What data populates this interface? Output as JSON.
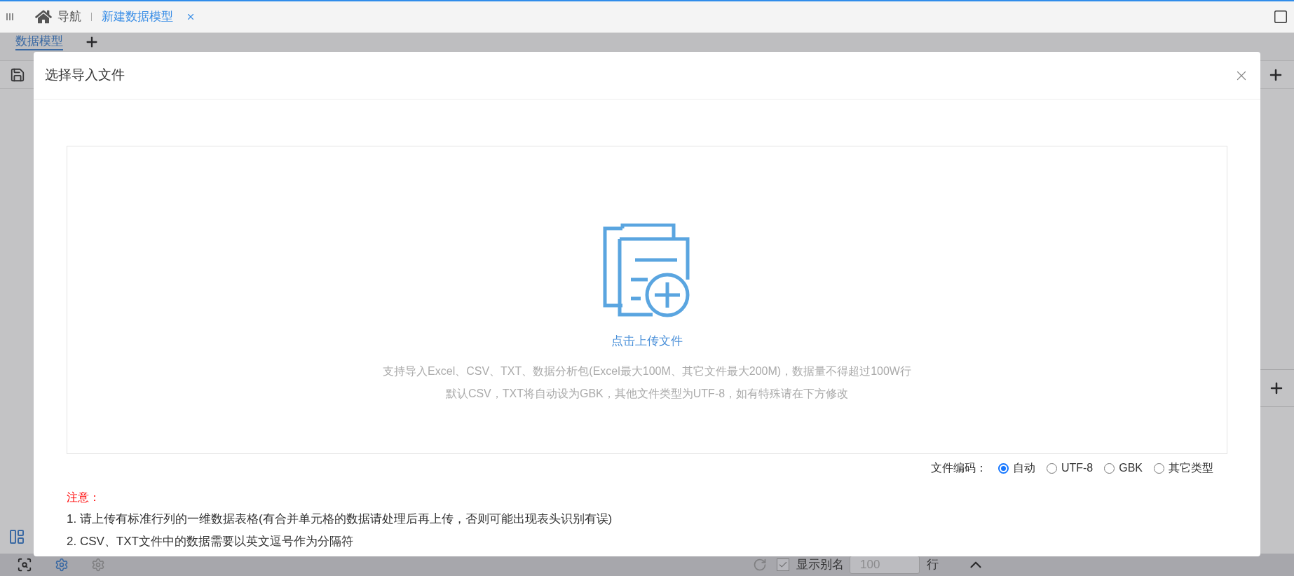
{
  "nav": {
    "label": "导航",
    "tabs": [
      {
        "label": "新建数据模型",
        "selected": true
      }
    ]
  },
  "page_tabs": [
    {
      "label": "数据模型",
      "selected": true
    }
  ],
  "dialog": {
    "title": "选择导入文件",
    "upload_label": "点击上传文件",
    "hints": [
      "支持导入Excel、CSV、TXT、数据分析包(Excel最大100M、其它文件最大200M)，数据量不得超过100W行",
      "默认CSV，TXT将自动设为GBK，其他文件类型为UTF-8，如有特殊请在下方修改"
    ],
    "encoding_label": "文件编码：",
    "encodings": [
      {
        "label": "自动",
        "selected": true
      },
      {
        "label": "UTF-8",
        "selected": false
      },
      {
        "label": "GBK",
        "selected": false
      },
      {
        "label": "其它类型",
        "selected": false
      }
    ],
    "notice_title": "注意：",
    "notices": [
      "1. 请上传有标准行列的一维数据表格(有合并单元格的数据请处理后再上传，否则可能出现表头识别有误)",
      "2. CSV、TXT文件中的数据需要以英文逗号作为分隔符"
    ]
  },
  "bottom_bar": {
    "show_alias": {
      "label": "显示别名",
      "checked": true
    },
    "row_count": {
      "value": "100"
    },
    "row_unit": "行"
  }
}
